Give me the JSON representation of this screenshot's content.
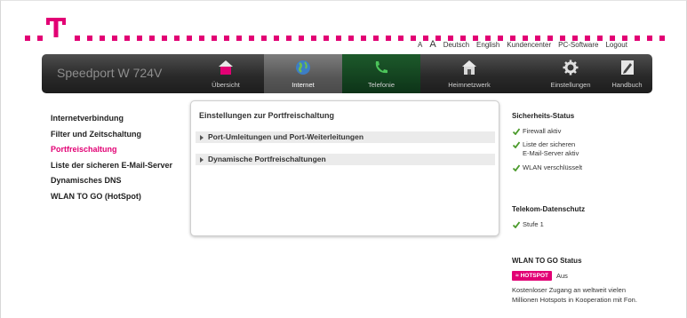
{
  "brand": {
    "device_name": "Speedport W 724V",
    "magenta": "#e20074",
    "logo_icon": "telekom-t-logo"
  },
  "toplinks": {
    "font_small": "A",
    "font_large": "A",
    "deutsch": "Deutsch",
    "english": "English",
    "kundencenter": "Kundencenter",
    "pc_software": "PC-Software",
    "logout": "Logout"
  },
  "nav": {
    "items": [
      {
        "label": "Übersicht",
        "icon": "house-icon"
      },
      {
        "label": "Internet",
        "icon": "globe-icon"
      },
      {
        "label": "Telefonie",
        "icon": "phone-icon"
      },
      {
        "label": "Heimnetzwerk",
        "icon": "home-network-icon"
      },
      {
        "label": "Einstellungen",
        "icon": "gear-icon"
      },
      {
        "label": "Handbuch",
        "icon": "manual-icon"
      }
    ],
    "active": "Internet"
  },
  "leftmenu": {
    "items": [
      "Internetverbindung",
      "Filter und Zeitschaltung",
      "Portfreischaltung",
      "Liste der sicheren E-Mail-Server",
      "Dynamisches DNS",
      "WLAN TO GO (HotSpot)"
    ],
    "selected": "Portfreischaltung"
  },
  "main": {
    "title": "Einstellungen zur Portfreischaltung",
    "sections": [
      "Port-Umleitungen und Port-Weiterleitungen",
      "Dynamische Portfreischaltungen"
    ]
  },
  "security": {
    "heading": "Sicherheits-Status",
    "items": [
      {
        "line1": "Firewall aktiv",
        "line2": ""
      },
      {
        "line1": "Liste der sicheren",
        "line2": "E-Mail-Server aktiv"
      },
      {
        "line1": "WLAN verschlüsselt",
        "line2": ""
      }
    ]
  },
  "privacy": {
    "heading": "Telekom-Datenschutz",
    "level": "Stufe 1"
  },
  "wlan_to_go": {
    "heading": "WLAN TO GO Status",
    "badge": "HOTSPOT",
    "status": "Aus",
    "desc_line1": "Kostenloser Zugang an weltweit vielen",
    "desc_line2": "Millionen Hotspots in Kooperation mit Fon."
  }
}
